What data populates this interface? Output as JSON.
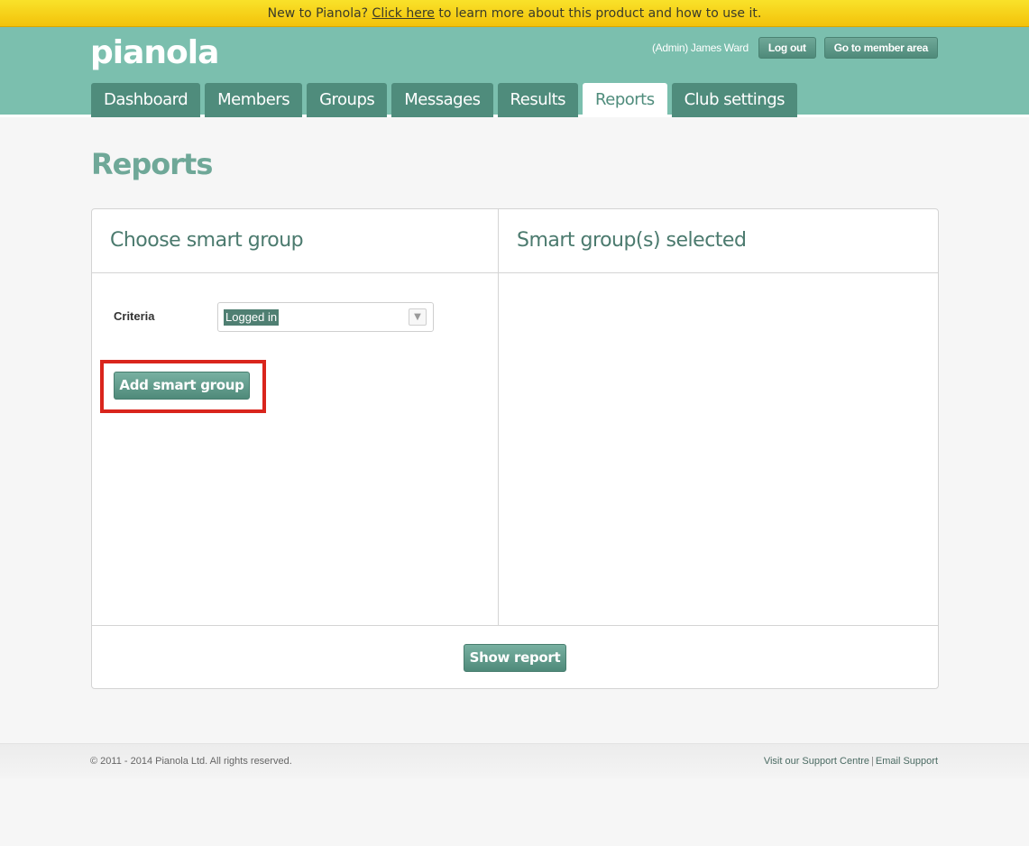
{
  "promo": {
    "prefix": "New to Pianola? ",
    "link": "Click here",
    "suffix": " to learn more about this product and how to use it."
  },
  "header": {
    "logo": "pianola",
    "user": "(Admin) James Ward",
    "logout_label": "Log out",
    "member_area_label": "Go to member area"
  },
  "nav": {
    "tabs": [
      {
        "label": "Dashboard"
      },
      {
        "label": "Members"
      },
      {
        "label": "Groups"
      },
      {
        "label": "Messages"
      },
      {
        "label": "Results"
      },
      {
        "label": "Reports",
        "active": true
      },
      {
        "label": "Club settings"
      }
    ]
  },
  "page": {
    "title": "Reports"
  },
  "left_panel": {
    "title": "Choose smart group",
    "criteria_label": "Criteria",
    "criteria_value": "Logged in",
    "add_button": "Add smart group"
  },
  "right_panel": {
    "title": "Smart group(s) selected"
  },
  "panel_footer": {
    "show_button": "Show report"
  },
  "footer": {
    "copyright": "© 2011 - 2014 Pianola Ltd. All rights reserved.",
    "support_centre": "Visit our Support Centre",
    "separator": "|",
    "email_support": "Email Support"
  },
  "colors": {
    "header": "#7bbfae",
    "nav_tab": "#4f8c7c",
    "promo": "#f5cf12",
    "highlight": "#d9251c"
  }
}
